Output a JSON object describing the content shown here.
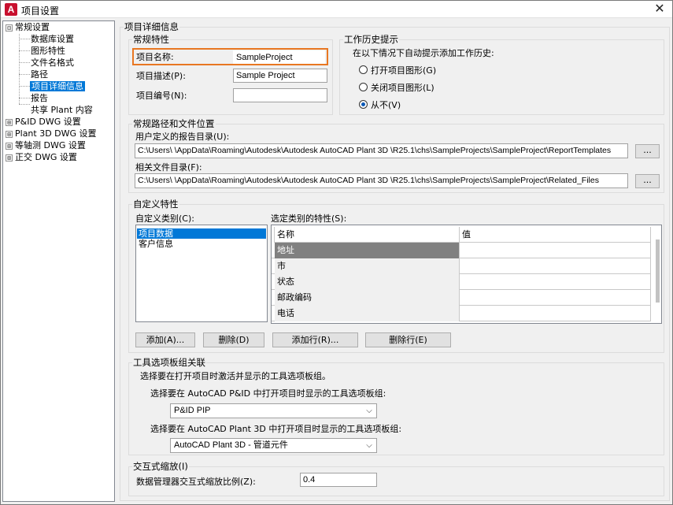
{
  "window": {
    "title": "项目设置",
    "app_icon": "A",
    "close": "✕"
  },
  "tree": {
    "items": [
      {
        "label": "常规设置",
        "expander": "⊟"
      },
      {
        "label": "数据库设置"
      },
      {
        "label": "图形特性"
      },
      {
        "label": "文件名格式"
      },
      {
        "label": "路径"
      },
      {
        "label": "项目详细信息",
        "selected": true
      },
      {
        "label": "报告"
      },
      {
        "label": "共享 Plant 内容"
      },
      {
        "label": "P&ID DWG 设置",
        "expander": "⊞"
      },
      {
        "label": "Plant 3D DWG 设置",
        "expander": "⊞"
      },
      {
        "label": "等轴测 DWG 设置",
        "expander": "⊞"
      },
      {
        "label": "正交 DWG 设置",
        "expander": "⊞"
      }
    ]
  },
  "main": {
    "section_title": "项目详细信息",
    "general": {
      "title": "常规特性",
      "name_label": "项目名称:",
      "name_value": "SampleProject",
      "desc_label": "项目描述(P):",
      "desc_value": "Sample Project",
      "num_label": "项目编号(N):",
      "num_value": ""
    },
    "history": {
      "title": "工作历史提示",
      "subtitle": "在以下情况下自动提示添加工作历史:",
      "options": [
        {
          "label": "打开项目图形(G)",
          "checked": false
        },
        {
          "label": "关闭项目图形(L)",
          "checked": false
        },
        {
          "label": "从不(V)",
          "checked": true
        }
      ]
    },
    "paths": {
      "title": "常规路径和文件位置",
      "report_label": "用户定义的报告目录(U):",
      "report_value": "C:\\Users\\      \\AppData\\Roaming\\Autodesk\\Autodesk AutoCAD Plant 3D       \\R25.1\\chs\\SampleProjects\\SampleProject\\ReportTemplates",
      "related_label": "相关文件目录(F):",
      "related_value": "C:\\Users\\      \\AppData\\Roaming\\Autodesk\\Autodesk AutoCAD Plant 3D       \\R25.1\\chs\\SampleProjects\\SampleProject\\Related_Files",
      "browse": "..."
    },
    "custom": {
      "title": "自定义特性",
      "category_label": "自定义类别(C):",
      "categories": [
        "项目数据",
        "客户信息"
      ],
      "props_label": "选定类别的特性(S):",
      "columns": [
        "名称",
        "值"
      ],
      "rows": [
        "地址",
        "市",
        "状态",
        "邮政编码",
        "电话"
      ],
      "btn_add": "添加(A)...",
      "btn_delete": "删除(D)",
      "btn_add_row": "添加行(R)...",
      "btn_delete_row": "删除行(E)"
    },
    "palette": {
      "title": "工具选项板组关联",
      "desc": "选择要在打开项目时激活并显示的工具选项板组。",
      "pid_label": "选择要在 AutoCAD P&ID 中打开项目时显示的工具选项板组:",
      "pid_value": "P&ID PIP",
      "p3d_label": "选择要在 AutoCAD Plant 3D 中打开项目时显示的工具选项板组:",
      "p3d_value": "AutoCAD Plant 3D - 管道元件"
    },
    "zoom": {
      "title": "交互式缩放(I)",
      "label": "数据管理器交互式缩放比例(Z):",
      "value": "0.4"
    }
  },
  "colors": {
    "selection": "#0078d7",
    "highlight_border": "#e87722",
    "brand": "#c8102e"
  }
}
